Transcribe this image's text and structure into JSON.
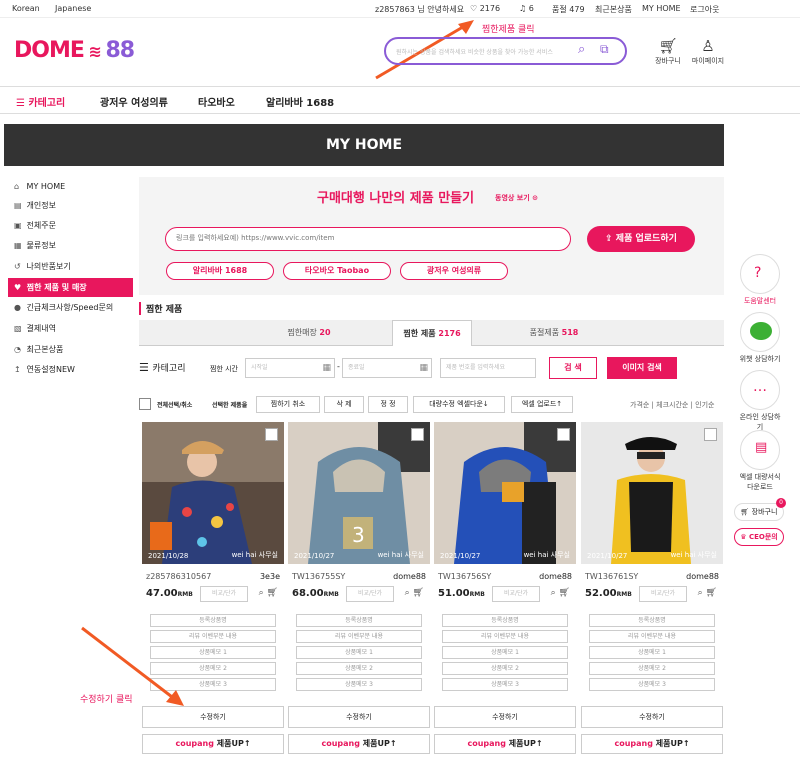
{
  "topbar": {
    "lang_korean": "Korean",
    "lang_japanese": "Japanese",
    "greeting": "z2857863 님 안녕하세요",
    "wish_count": "2176",
    "bell_count": "6",
    "points": "품절 479",
    "recent": "최근본상품",
    "myhome": "MY HOME",
    "logout": "로그아웃"
  },
  "annotations": {
    "wish_click": "찜한제품 클릭",
    "edit_click": "수정하기 클릭"
  },
  "header": {
    "logo_text": "DOME",
    "logo_num": "88",
    "search_placeholder": "원하시는 상품을 검색하세요 비슷한 상품을 찾아 가능한 서비스",
    "cart_label": "장바구니",
    "mypage_label": "마이페이지"
  },
  "nav": {
    "category": "카테고리",
    "item1": "광저우 여성의류",
    "item2": "타오바오",
    "item3": "알리바바 1688"
  },
  "banner": {
    "title": "MY HOME"
  },
  "sidebar": {
    "items": [
      {
        "label": "MY HOME",
        "icon": "⌂"
      },
      {
        "label": "개인정보",
        "icon": "▤"
      },
      {
        "label": "전체주문",
        "icon": "▣"
      },
      {
        "label": "물류정보",
        "icon": "▦"
      },
      {
        "label": "나의반품보기",
        "icon": "↺"
      },
      {
        "label": "찜한 제품 및 매장",
        "icon": "♥"
      },
      {
        "label": "긴급체크사항/Speed문의",
        "icon": "●"
      },
      {
        "label": "결제내역",
        "icon": "▧"
      },
      {
        "label": "최근본상품",
        "icon": "◔"
      },
      {
        "label": "연동설정NEW",
        "icon": "↥"
      }
    ]
  },
  "hero": {
    "title": "구매대행 나만의 제품 만들기",
    "video_link": "동영상 보기",
    "link_placeholder": "링크를 입력하세요예) https://www.vvic.com/item",
    "upload_button": "제품 업로드하기",
    "pill1": "알리바바 1688",
    "pill2": "타오바오 Taobao",
    "pill3": "광저우 여성의류"
  },
  "section": {
    "title": "찜한 제품"
  },
  "tabs": [
    {
      "label": "찜한매장",
      "count": "20"
    },
    {
      "label": "찜한 제품",
      "count": "2176"
    },
    {
      "label": "품절제품",
      "count": "518"
    }
  ],
  "filter": {
    "category": "카테고리",
    "time_label": "찜한 시간",
    "start_ph": "시작일",
    "end_ph": "종료일",
    "code_ph": "제품 번호를 입력하세요",
    "search_btn": "검 색",
    "image_search_btn": "이미지 검색"
  },
  "actions": {
    "select_all": "전체선택/취소",
    "selected_label": "선택한 제품을",
    "cancel_wish": "찜하기 취소",
    "delete": "삭 제",
    "edit": "정 정",
    "bulk_edit": "대량수정 엑셀다운↓",
    "excel_upload": "엑셀 업로드↑",
    "sort": "가격순 | 체크시간순 | 인기순"
  },
  "products": [
    {
      "date": "2021/10/28",
      "seller": "wei hai 사무실",
      "code": "z285786310567",
      "vendor": "3e3e",
      "price": "47.00",
      "unit": "RMB"
    },
    {
      "date": "2021/10/27",
      "seller": "wei hai 사무실",
      "code": "TW136755SY",
      "vendor": "dome88",
      "price": "68.00",
      "unit": "RMB"
    },
    {
      "date": "2021/10/27",
      "seller": "wei hai 사무실",
      "code": "TW136756SY",
      "vendor": "dome88",
      "price": "51.00",
      "unit": "RMB"
    },
    {
      "date": "2021/10/27",
      "seller": "wei hai 사무실",
      "code": "TW136761SY",
      "vendor": "dome88",
      "price": "52.00",
      "unit": "RMB"
    }
  ],
  "card_labels": {
    "compare": "비교/단가",
    "memo1": "등록상품명",
    "memo2": "리뷰 이벤부분 내용",
    "memo3": "상품메모 1",
    "memo4": "상품메모 2",
    "memo5": "상품메모 3",
    "edit": "수정하기",
    "coupang": "coupang",
    "product_up": "제품UP↑"
  },
  "rightbar": {
    "help": "도움말센터",
    "wechat": "위챗 상담하기",
    "online": "온라인 상담하기",
    "excel": "엑셀 대량서식 다운로드",
    "cart": "장바구니",
    "cart_count": "0",
    "ceo": "CEO문의"
  }
}
